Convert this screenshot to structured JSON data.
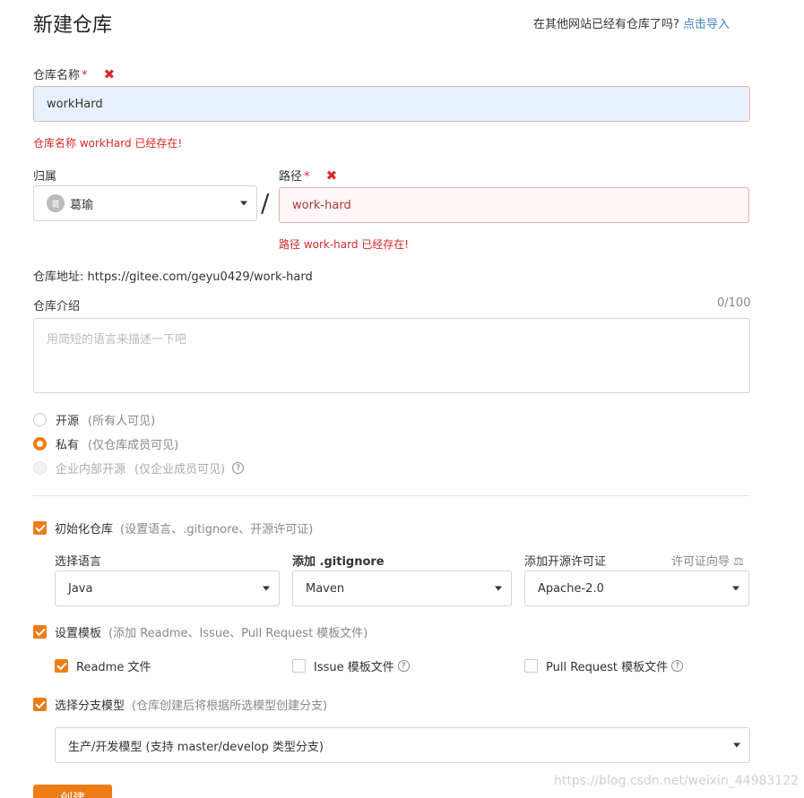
{
  "header": {
    "title": "新建仓库",
    "import_prompt": "在其他网站已经有仓库了吗?",
    "import_link": "点击导入"
  },
  "repo_name": {
    "label": "仓库名称",
    "required_mark": "*",
    "error_icon": "✖",
    "value": "workHard",
    "error": "仓库名称 workHard 已经存在!"
  },
  "owner": {
    "label": "归属",
    "avatar_text": "葛",
    "value": "葛瑜"
  },
  "slash": "/",
  "path": {
    "label": "路径",
    "required_mark": "*",
    "error_icon": "✖",
    "value": "work-hard",
    "error": "路径 work-hard 已经存在!"
  },
  "repo_url": {
    "label": "仓库地址:",
    "value": "https://gitee.com/geyu0429/work-hard"
  },
  "description": {
    "label": "仓库介绍",
    "counter": "0/100",
    "placeholder": "用简短的语言来描述一下吧"
  },
  "visibility": [
    {
      "label": "开源",
      "note": "(所有人可见)",
      "state": "off"
    },
    {
      "label": "私有",
      "note": "(仅仓库成员可见)",
      "state": "on"
    },
    {
      "label": "企业内部开源",
      "note": "(仅企业成员可见)",
      "state": "disabled"
    }
  ],
  "help_icon": "?",
  "init": {
    "label": "初始化仓库",
    "note": "(设置语言、.gitignore、开源许可证)",
    "checked": true,
    "language_label": "选择语言",
    "language_value": "Java",
    "gitignore_label": "添加 .gitignore",
    "gitignore_value": "Maven",
    "license_label": "添加开源许可证",
    "license_guide": "许可证向导",
    "license_guide_icon": "⚖",
    "license_value": "Apache-2.0"
  },
  "template": {
    "label": "设置模板",
    "note": "(添加 Readme、Issue、Pull Request 模板文件)",
    "checked": true,
    "readme": "Readme 文件",
    "issue": "Issue 模板文件",
    "pr": "Pull Request 模板文件"
  },
  "branch": {
    "label": "选择分支模型",
    "note": "(仓库创建后将根据所选模型创建分支)",
    "checked": true,
    "value": "生产/开发模型 (支持 master/develop 类型分支)"
  },
  "submit_label": "创建",
  "watermark": "https://blog.csdn.net/weixin_44983122",
  "colors": {
    "accent": "#ee7d16",
    "error": "#db2828",
    "link": "#4183c4"
  }
}
